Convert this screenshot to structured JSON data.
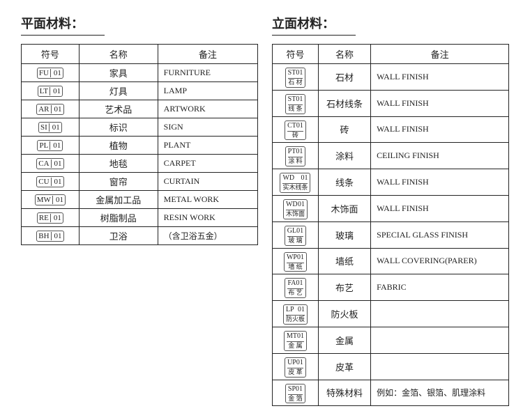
{
  "left": {
    "title": "平面材料：",
    "headers": [
      "符号",
      "名称",
      "备注"
    ],
    "rows": [
      {
        "code": "FU",
        "num": "01",
        "name": "家具",
        "note": "FURNITURE"
      },
      {
        "code": "LT",
        "num": "01",
        "name": "灯具",
        "note": "LAMP"
      },
      {
        "code": "AR",
        "num": "01",
        "name": "艺术品",
        "note": "ARTWORK"
      },
      {
        "code": "SI",
        "num": "01",
        "name": "标识",
        "note": "SIGN"
      },
      {
        "code": "PL",
        "num": "01",
        "name": "植物",
        "note": "PLANT"
      },
      {
        "code": "CA",
        "num": "01",
        "name": "地毯",
        "note": "CARPET"
      },
      {
        "code": "CU",
        "num": "01",
        "name": "窗帘",
        "note": "CURTAIN"
      },
      {
        "code": "MW",
        "num": "01",
        "name": "金属加工品",
        "note": "METAL WORK"
      },
      {
        "code": "RE",
        "num": "01",
        "name": "树脂制品",
        "note": "RESIN WORK"
      },
      {
        "code": "BH",
        "num": "01",
        "name": "卫浴",
        "note": "（含卫浴五金）"
      }
    ]
  },
  "right": {
    "title": "立面材料：",
    "headers": [
      "符号",
      "名称",
      "备注"
    ],
    "rows": [
      {
        "code": "ST",
        "num": "01",
        "sub": "石 材",
        "name": "石材",
        "note": "WALL FINISH"
      },
      {
        "code": "ST",
        "num": "01",
        "sub": "线 条",
        "name": "石材线条",
        "note": "WALL FINISH"
      },
      {
        "code": "CT",
        "num": "01",
        "sub": "砖",
        "name": "砖",
        "note": "WALL FINISH"
      },
      {
        "code": "PT",
        "num": "01",
        "sub": "涂 料",
        "name": "涂料",
        "note": "CEILING FINISH"
      },
      {
        "code": "WD",
        "num": "01",
        "sub": "实木线条",
        "name": "线条",
        "note": "WALL FINISH"
      },
      {
        "code": "WD",
        "num": "01",
        "sub": "木饰面",
        "name": "木饰面",
        "note": "WALL FINISH"
      },
      {
        "code": "GL",
        "num": "01",
        "sub": "玻 璃",
        "name": "玻璃",
        "note": "SPECIAL GLASS FINISH"
      },
      {
        "code": "WP",
        "num": "01",
        "sub": "墙 纸",
        "name": "墙纸",
        "note": "WALL COVERING(PARER)"
      },
      {
        "code": "FA",
        "num": "01",
        "sub": "布 艺",
        "name": "布艺",
        "note": "FABRIC"
      },
      {
        "code": "LP",
        "num": "01",
        "sub": "防火板",
        "name": "防火板",
        "note": ""
      },
      {
        "code": "MT",
        "num": "01",
        "sub": "金 属",
        "name": "金属",
        "note": ""
      },
      {
        "code": "UP",
        "num": "01",
        "sub": "皮 革",
        "name": "皮革",
        "note": ""
      },
      {
        "code": "SP",
        "num": "01",
        "sub": "金 箔",
        "name": "特殊材料",
        "note": "例如：金箔、银箔、肌理涂料"
      }
    ]
  }
}
